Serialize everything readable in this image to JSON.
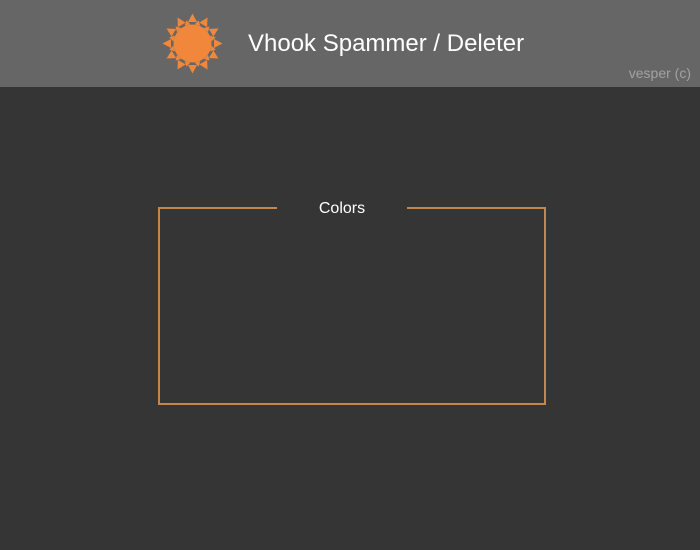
{
  "header": {
    "title": "Vhook Spammer / Deleter",
    "credit": "vesper (c)",
    "logo_icon": "sun-icon"
  },
  "panel": {
    "legend": "Colors"
  },
  "colors": {
    "background": "#353535",
    "header_background": "#666666",
    "accent": "#f0873a",
    "panel_border": "#c4864a",
    "title_text": "#ffffff",
    "credit_text": "#a2a2a2"
  }
}
